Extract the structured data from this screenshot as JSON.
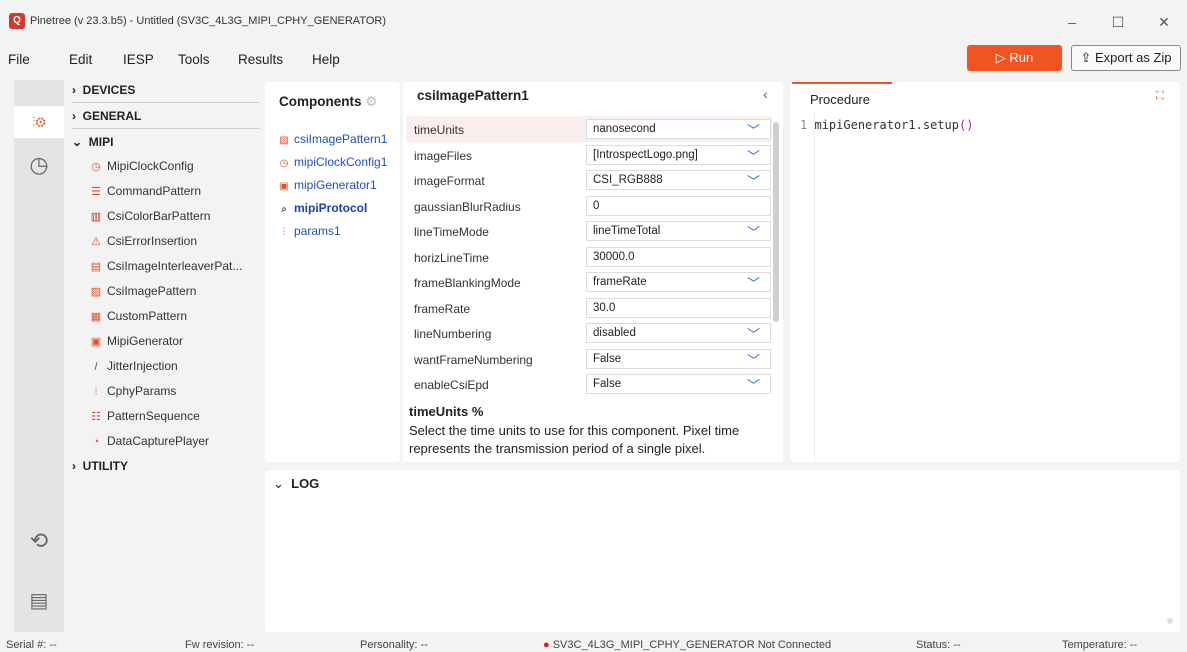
{
  "window": {
    "title": "Pinetree (v 23.3.b5) - Untitled (SV3C_4L3G_MIPI_CPHY_GENERATOR)",
    "minimize": "–",
    "maximize": "☐",
    "close": "✕"
  },
  "menu": [
    "File",
    "Edit",
    "IESP",
    "Tools",
    "Results",
    "Help"
  ],
  "toolbar": {
    "run_label": "▷ Run",
    "export_label": "⇪ Export as Zip"
  },
  "tree": {
    "devices": "DEVICES",
    "general": "GENERAL",
    "mipi": "MIPI",
    "utility": "UTILITY",
    "items": [
      {
        "label": "MipiClockConfig",
        "icon": "clock-icon",
        "glyph": "◷",
        "color": "#e0502a"
      },
      {
        "label": "CommandPattern",
        "icon": "list-icon",
        "glyph": "☰",
        "color": "#e0502a"
      },
      {
        "label": "CsiColorBarPattern",
        "icon": "color-bar-icon",
        "glyph": "▥",
        "color": "#c03020"
      },
      {
        "label": "CsiErrorInsertion",
        "icon": "warning-icon",
        "glyph": "⚠",
        "color": "#e0502a"
      },
      {
        "label": "CsiImageInterleaverPat...",
        "icon": "interleaver-icon",
        "glyph": "▤",
        "color": "#e0502a"
      },
      {
        "label": "CsiImagePattern",
        "icon": "image-icon",
        "glyph": "▨",
        "color": "#e0502a"
      },
      {
        "label": "CustomPattern",
        "icon": "custom-pattern-icon",
        "glyph": "▦",
        "color": "#e0502a"
      },
      {
        "label": "MipiGenerator",
        "icon": "generator-icon",
        "glyph": "▣",
        "color": "#e0502a"
      },
      {
        "label": "JitterInjection",
        "icon": "jitter-icon",
        "glyph": "/",
        "color": "#555"
      },
      {
        "label": "CphyParams",
        "icon": "params-icon",
        "glyph": "⫶",
        "color": "#e0502a"
      },
      {
        "label": "PatternSequence",
        "icon": "sequence-icon",
        "glyph": "☷",
        "color": "#e0502a"
      },
      {
        "label": "DataCapturePlayer",
        "icon": "capture-icon",
        "glyph": "◔",
        "color": "#e0502a"
      }
    ]
  },
  "components": {
    "title": "Components",
    "items": [
      {
        "label": "csiImagePattern1",
        "icon": "image-icon",
        "glyph": "▨",
        "bold": false
      },
      {
        "label": "mipiClockConfig1",
        "icon": "clock-icon",
        "glyph": "◷",
        "bold": false
      },
      {
        "label": "mipiGenerator1",
        "icon": "generator-icon",
        "glyph": "▣",
        "bold": false
      },
      {
        "label": "mipiProtocol",
        "icon": "protocol-icon",
        "glyph": "⌕",
        "bold": true
      },
      {
        "label": "params1",
        "icon": "params-icon",
        "glyph": "⫶",
        "bold": false
      }
    ]
  },
  "properties": {
    "title": "csiImagePattern1",
    "rows": [
      {
        "name": "timeUnits",
        "value": "nanosecond",
        "dropdown": true
      },
      {
        "name": "imageFiles",
        "value": "[IntrospectLogo.png]",
        "dropdown": true
      },
      {
        "name": "imageFormat",
        "value": "CSI_RGB888",
        "dropdown": true
      },
      {
        "name": "gaussianBlurRadius",
        "value": "0",
        "dropdown": false
      },
      {
        "name": "lineTimeMode",
        "value": "lineTimeTotal",
        "dropdown": true
      },
      {
        "name": "horizLineTime",
        "value": "30000.0",
        "dropdown": false
      },
      {
        "name": "frameBlankingMode",
        "value": "frameRate",
        "dropdown": true
      },
      {
        "name": "frameRate",
        "value": "30.0",
        "dropdown": false
      },
      {
        "name": "lineNumbering",
        "value": "disabled",
        "dropdown": true
      },
      {
        "name": "wantFrameNumbering",
        "value": "False",
        "dropdown": true
      },
      {
        "name": "enableCsiEpd",
        "value": "False",
        "dropdown": true
      }
    ],
    "help_title": "timeUnits %",
    "help_text": "Select the time units to use for this component. Pixel time represents the transmission period of a single pixel."
  },
  "procedure": {
    "tab": "Procedure",
    "line_number": "1",
    "code": "mipiGenerator1.setup",
    "parens": "()"
  },
  "log": {
    "title": "LOG"
  },
  "status": {
    "serial": "Serial #: --",
    "fw": "Fw revision: --",
    "personality": "Personality: --",
    "connection": "SV3C_4L3G_MIPI_CPHY_GENERATOR Not Connected",
    "status": "Status: --",
    "temperature": "Temperature: --"
  },
  "colors": {
    "accent": "#f05420",
    "link": "#1f4fc8",
    "disconnected": "#d32020"
  }
}
